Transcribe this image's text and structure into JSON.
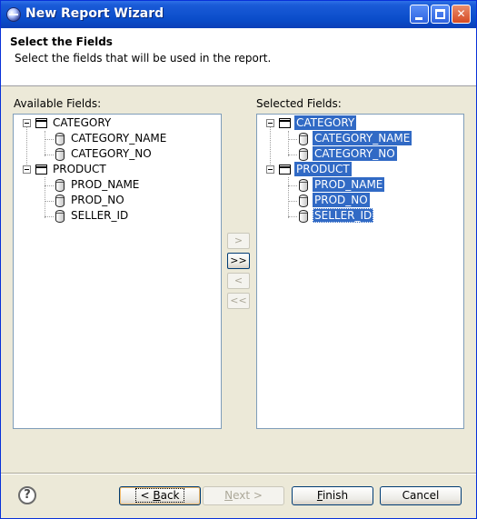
{
  "window": {
    "title": "New Report Wizard"
  },
  "header": {
    "title": "Select the Fields",
    "description": "Select the fields that will be used in the report."
  },
  "available": {
    "label": "Available Fields:",
    "tables": [
      {
        "name": "CATEGORY",
        "columns": [
          "CATEGORY_NAME",
          "CATEGORY_NO"
        ]
      },
      {
        "name": "PRODUCT",
        "columns": [
          "PROD_NAME",
          "PROD_NO",
          "SELLER_ID"
        ]
      }
    ]
  },
  "selected": {
    "label": "Selected Fields:",
    "tables": [
      {
        "name": "CATEGORY",
        "columns": [
          "CATEGORY_NAME",
          "CATEGORY_NO"
        ]
      },
      {
        "name": "PRODUCT",
        "columns": [
          "PROD_NAME",
          "PROD_NO",
          "SELLER_ID"
        ]
      }
    ]
  },
  "transfer": {
    "add": ">",
    "add_all": ">>",
    "remove": "<",
    "remove_all": "<<"
  },
  "footer": {
    "help": "?",
    "back_mnemonic": "B",
    "back_rest": "ack",
    "back_arrow": "< ",
    "next_mnemonic": "N",
    "next_rest": "ext >",
    "finish_mnemonic": "F",
    "finish_rest": "inish",
    "cancel": "Cancel"
  }
}
